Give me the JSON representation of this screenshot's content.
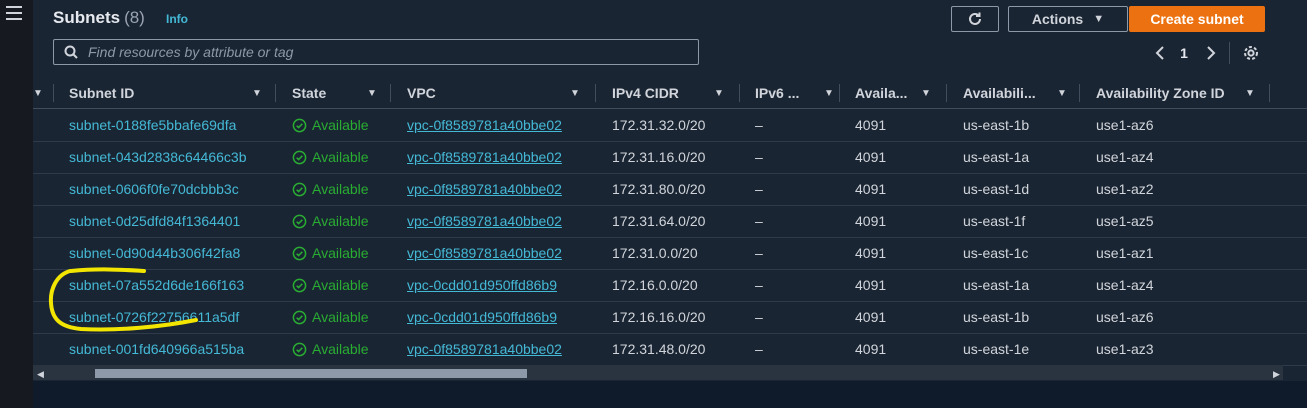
{
  "header": {
    "title": "Subnets",
    "count": "(8)",
    "info": "Info",
    "actions_label": "Actions",
    "create_label": "Create subnet",
    "search_placeholder": "Find resources by attribute or tag",
    "page": "1"
  },
  "icons": {
    "refresh": "refresh-icon",
    "search": "search-icon",
    "settings": "gear-icon",
    "menu": "hamburger-icon",
    "status": "check-circle-icon"
  },
  "colors": {
    "accent": "#ec7211",
    "link": "#44b9d6",
    "status_available": "#29ad32",
    "annotation": "#f2e600"
  },
  "columns": [
    "Subnet ID",
    "State",
    "VPC",
    "IPv4 CIDR",
    "IPv6 ...",
    "Availa...",
    "Availabili...",
    "Availability Zone ID"
  ],
  "rows": [
    {
      "subnet_id": "subnet-0188fe5bbafe69dfa",
      "state": "Available",
      "vpc": "vpc-0f8589781a40bbe02",
      "ipv4": "172.31.32.0/20",
      "ipv6": "–",
      "available_ips": "4091",
      "az": "us-east-1b",
      "az_id": "use1-az6"
    },
    {
      "subnet_id": "subnet-043d2838c64466c3b",
      "state": "Available",
      "vpc": "vpc-0f8589781a40bbe02",
      "ipv4": "172.31.16.0/20",
      "ipv6": "–",
      "available_ips": "4091",
      "az": "us-east-1a",
      "az_id": "use1-az4"
    },
    {
      "subnet_id": "subnet-0606f0fe70dcbbb3c",
      "state": "Available",
      "vpc": "vpc-0f8589781a40bbe02",
      "ipv4": "172.31.80.0/20",
      "ipv6": "–",
      "available_ips": "4091",
      "az": "us-east-1d",
      "az_id": "use1-az2"
    },
    {
      "subnet_id": "subnet-0d25dfd84f1364401",
      "state": "Available",
      "vpc": "vpc-0f8589781a40bbe02",
      "ipv4": "172.31.64.0/20",
      "ipv6": "–",
      "available_ips": "4091",
      "az": "us-east-1f",
      "az_id": "use1-az5"
    },
    {
      "subnet_id": "subnet-0d90d44b306f42fa8",
      "state": "Available",
      "vpc": "vpc-0f8589781a40bbe02",
      "ipv4": "172.31.0.0/20",
      "ipv6": "–",
      "available_ips": "4091",
      "az": "us-east-1c",
      "az_id": "use1-az1"
    },
    {
      "subnet_id": "subnet-07a552d6de166f163",
      "state": "Available",
      "vpc": "vpc-0cdd01d950ffd86b9",
      "ipv4": "172.16.0.0/20",
      "ipv6": "–",
      "available_ips": "4091",
      "az": "us-east-1a",
      "az_id": "use1-az4"
    },
    {
      "subnet_id": "subnet-0726f22756611a5df",
      "state": "Available",
      "vpc": "vpc-0cdd01d950ffd86b9",
      "ipv4": "172.16.16.0/20",
      "ipv6": "–",
      "available_ips": "4091",
      "az": "us-east-1b",
      "az_id": "use1-az6"
    },
    {
      "subnet_id": "subnet-001fd640966a515ba",
      "state": "Available",
      "vpc": "vpc-0f8589781a40bbe02",
      "ipv4": "172.31.48.0/20",
      "ipv6": "–",
      "available_ips": "4091",
      "az": "us-east-1e",
      "az_id": "use1-az3"
    }
  ]
}
